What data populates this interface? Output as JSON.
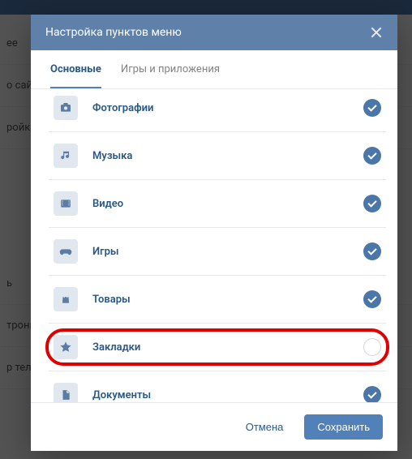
{
  "bg": {
    "items": [
      "ee",
      "о сайта",
      "ройки",
      "ь",
      "тронная",
      "р телес"
    ]
  },
  "modal": {
    "title": "Настройка пунктов меню",
    "tabs": {
      "primary": "Основные",
      "secondary": "Игры и приложения"
    },
    "items": [
      {
        "icon": "photo-icon",
        "label": "Фотографии",
        "on": true,
        "highlighted": false
      },
      {
        "icon": "music-icon",
        "label": "Музыка",
        "on": true,
        "highlighted": false
      },
      {
        "icon": "video-icon",
        "label": "Видео",
        "on": true,
        "highlighted": false
      },
      {
        "icon": "games-icon",
        "label": "Игры",
        "on": true,
        "highlighted": false
      },
      {
        "icon": "market-icon",
        "label": "Товары",
        "on": true,
        "highlighted": false
      },
      {
        "icon": "star-icon",
        "label": "Закладки",
        "on": false,
        "highlighted": true
      },
      {
        "icon": "doc-icon",
        "label": "Документы",
        "on": true,
        "highlighted": false
      }
    ],
    "footer": {
      "cancel": "Отмена",
      "save": "Сохранить"
    }
  }
}
